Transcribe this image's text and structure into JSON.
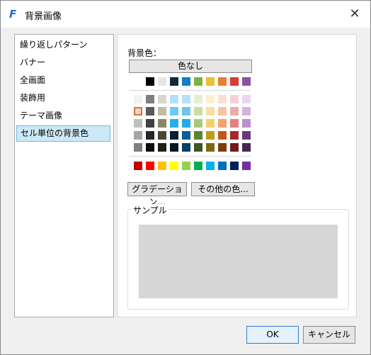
{
  "window": {
    "title": "背景画像",
    "app_icon": "app-f-icon",
    "close_icon": "close-icon"
  },
  "nav": {
    "items": [
      {
        "label": "繰り返しパターン",
        "selected": false
      },
      {
        "label": "バナー",
        "selected": false
      },
      {
        "label": "全画面",
        "selected": false
      },
      {
        "label": "装飾用",
        "selected": false
      },
      {
        "label": "テーマ画像",
        "selected": false
      },
      {
        "label": "セル単位の背景色",
        "selected": true
      }
    ]
  },
  "panel": {
    "bg_label": "背景色：",
    "no_color_button": "色なし",
    "gradation_button": "グラデーション...",
    "other_colors_button": "その他の色...",
    "sample_label": "サンプル",
    "sample_color": "#d6d6d6"
  },
  "palette": {
    "top_row": [
      "#ffffff",
      "#000000",
      "#e7e6e6",
      "#0e2841",
      "#0f7fc8",
      "#7fb03e",
      "#e9c136",
      "#ee7c31",
      "#d73b3b",
      "#8b4fa4"
    ],
    "theme_rows": [
      [
        "#f2f2f2",
        "#7f7f7f",
        "#d9d6cf",
        "#b4e0f8",
        "#b7dff8",
        "#e3eecf",
        "#fbefcd",
        "#fbdfd0",
        "#f5d2d2",
        "#e8d8ef"
      ],
      [
        "#d9d9d9",
        "#595959",
        "#c1bc9e",
        "#6ecaf2",
        "#73c3f0",
        "#c7dda8",
        "#f7e0a0",
        "#f8c2a1",
        "#edaaaa",
        "#d3b4df"
      ],
      [
        "#bfbfbf",
        "#404040",
        "#8a8668",
        "#28aee8",
        "#28a8e8",
        "#a9c97a",
        "#f2d16a",
        "#f4a36f",
        "#e47f7f",
        "#bd8ece"
      ],
      [
        "#a6a6a6",
        "#262626",
        "#49472f",
        "#0c2033",
        "#0b5f96",
        "#5e8330",
        "#c19a1b",
        "#bc5a16",
        "#a82929",
        "#68387b"
      ],
      [
        "#808080",
        "#0d0d0d",
        "#1f1e14",
        "#081522",
        "#074064",
        "#3f5720",
        "#806612",
        "#7d3c0e",
        "#701b1b",
        "#452552"
      ]
    ],
    "standard_row": [
      "#c00000",
      "#ff0000",
      "#ffc000",
      "#ffff00",
      "#92d050",
      "#00b050",
      "#00b0f0",
      "#0070c0",
      "#002060",
      "#7030a0"
    ],
    "selected_swatch": "theme_rows.1.0",
    "selection_border": "#e07030"
  },
  "footer": {
    "ok": "OK",
    "cancel": "キャンセル"
  }
}
